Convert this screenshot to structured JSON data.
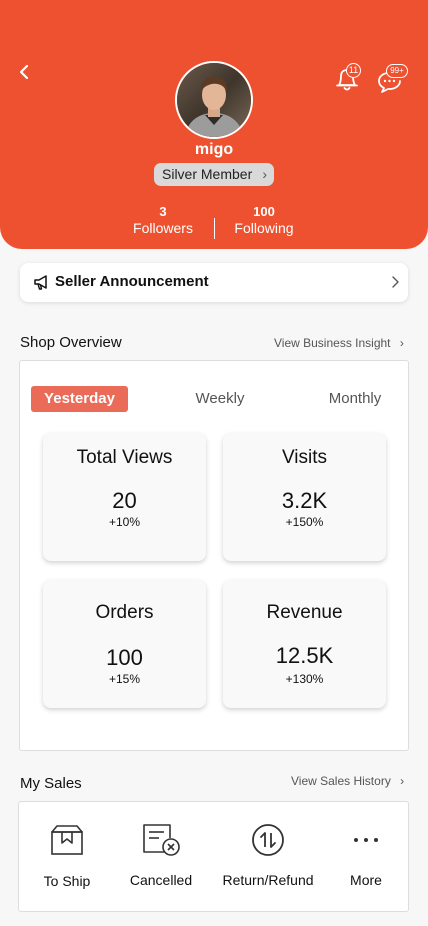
{
  "header": {
    "username": "migo",
    "badges": {
      "notifications": "11",
      "messages": "99+"
    },
    "member_level": "Silver Member",
    "followers": {
      "count": "3",
      "label": "Followers"
    },
    "following": {
      "count": "100",
      "label": "Following"
    },
    "bg_color": "#ee512f"
  },
  "announcement": {
    "label": "Seller Announcement"
  },
  "shop_overview": {
    "title": "Shop Overview",
    "link": "View Business Insight",
    "tabs": [
      {
        "label": "Yesterday",
        "active": true
      },
      {
        "label": "Weekly",
        "active": false
      },
      {
        "label": "Monthly",
        "active": false
      }
    ],
    "metrics": [
      {
        "title": "Total Views",
        "value": "20",
        "change": "+10%"
      },
      {
        "title": "Visits",
        "value": "3.2K",
        "change": "+150%"
      },
      {
        "title": "Orders",
        "value": "100",
        "change": "+15%"
      },
      {
        "title": "Revenue",
        "value": "12.5K",
        "change": "+130%"
      }
    ]
  },
  "my_sales": {
    "title": "My Sales",
    "link": "View Sales History",
    "items": [
      {
        "label": "To Ship",
        "icon": "box-icon"
      },
      {
        "label": "Cancelled",
        "icon": "cancelled-order-icon"
      },
      {
        "label": "Return/Refund",
        "icon": "return-refund-icon"
      },
      {
        "label": "More",
        "icon": "more-dots-icon"
      }
    ]
  }
}
